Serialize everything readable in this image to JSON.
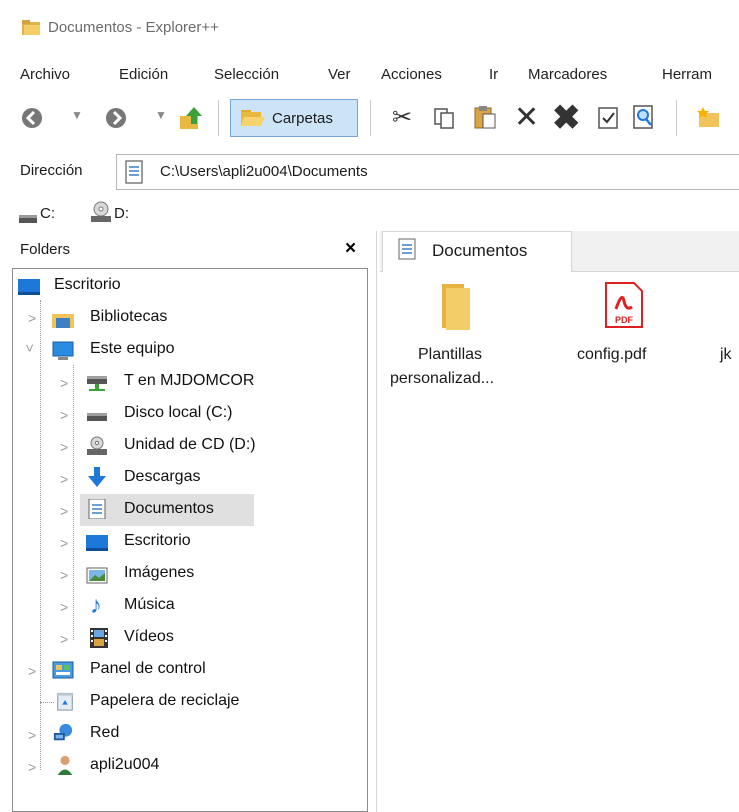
{
  "window": {
    "title": "Documentos - Explorer++"
  },
  "menu": [
    "Archivo",
    "Edición",
    "Selección",
    "Ver",
    "Acciones",
    "Ir",
    "Marcadores",
    "Herram"
  ],
  "toolbar": {
    "folders_label": "Carpetas"
  },
  "address": {
    "label": "Dirección",
    "path": "C:\\Users\\apli2u004\\Documents"
  },
  "drives": {
    "c": "C:",
    "d": "D:"
  },
  "folders_pane": {
    "title": "Folders",
    "close": "×",
    "items": [
      {
        "label": "Escritorio",
        "icon": "desktop-icon"
      },
      {
        "label": "Bibliotecas",
        "icon": "libraries-icon"
      },
      {
        "label": "Este equipo",
        "icon": "computer-icon"
      },
      {
        "label": "T en MJDOMCOR",
        "icon": "network-drive-icon"
      },
      {
        "label": "Disco local (C:)",
        "icon": "drive-icon"
      },
      {
        "label": "Unidad de CD (D:)",
        "icon": "cd-drive-icon"
      },
      {
        "label": "Descargas",
        "icon": "download-icon"
      },
      {
        "label": "Documentos",
        "icon": "document-icon"
      },
      {
        "label": "Escritorio",
        "icon": "desktop-icon"
      },
      {
        "label": "Imágenes",
        "icon": "pictures-icon"
      },
      {
        "label": "Música",
        "icon": "music-icon"
      },
      {
        "label": "Vídeos",
        "icon": "videos-icon"
      },
      {
        "label": "Panel de control",
        "icon": "control-panel-icon"
      },
      {
        "label": "Papelera de reciclaje",
        "icon": "recycle-bin-icon"
      },
      {
        "label": "Red",
        "icon": "network-icon"
      },
      {
        "label": "apli2u004",
        "icon": "user-icon"
      }
    ]
  },
  "tabs": [
    {
      "label": "Documentos"
    }
  ],
  "files": [
    {
      "line1": "Plantillas",
      "line2": "personalizad...",
      "icon": "folder-icon"
    },
    {
      "line1": "config.pdf",
      "line2": "",
      "icon": "pdf-icon"
    },
    {
      "line1": "jk",
      "line2": "",
      "icon": "file-icon"
    }
  ],
  "colors": {
    "accent": "#1e78d7",
    "selection": "#e0e0e0",
    "folder": "#f0c45a",
    "pdf": "#e02020"
  }
}
